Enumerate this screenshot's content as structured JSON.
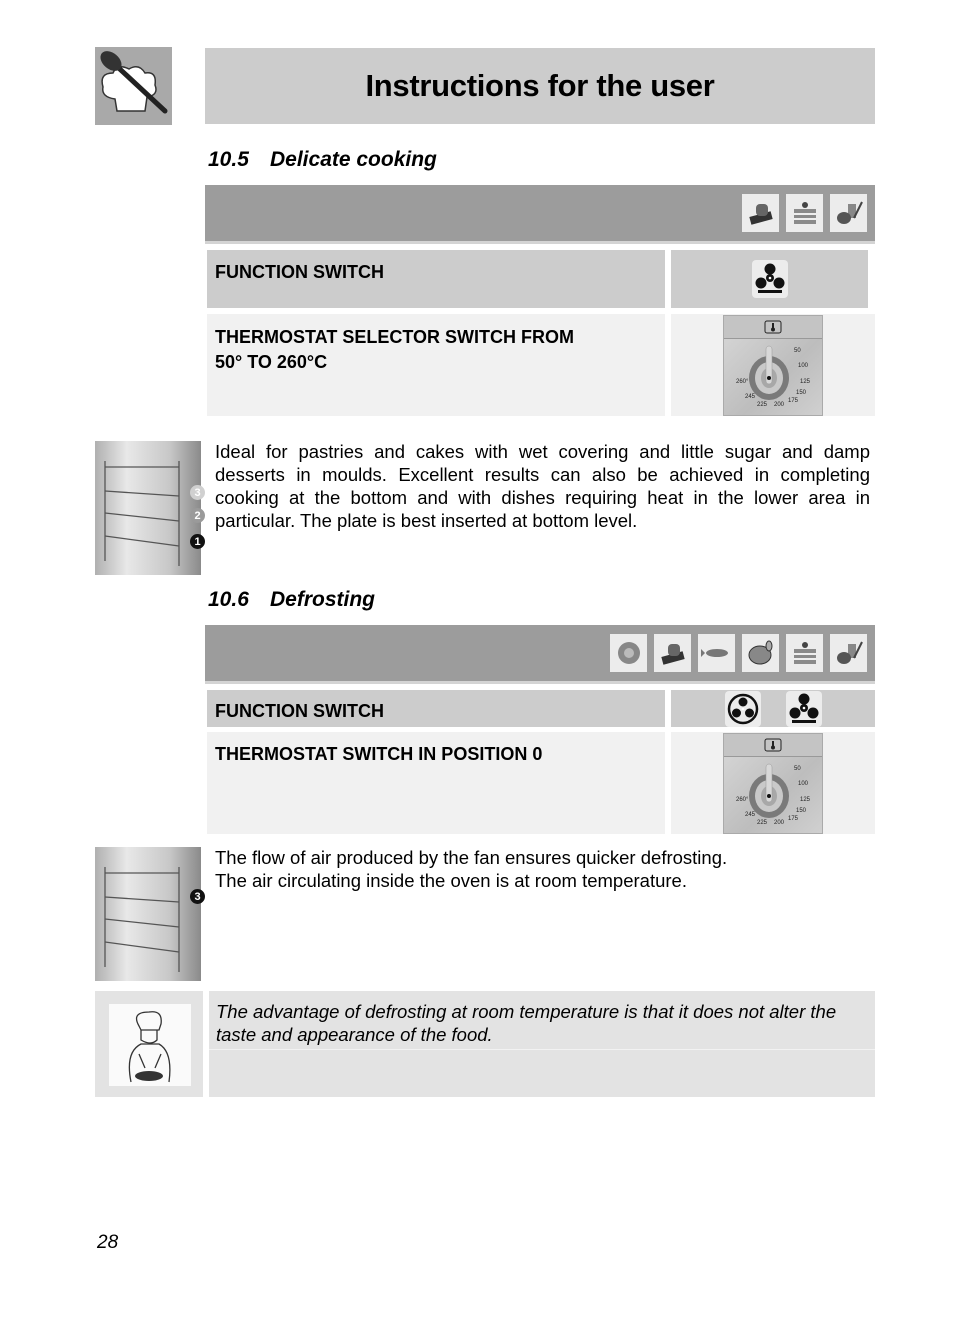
{
  "header": {
    "title": "Instructions for the user",
    "logo_icon": "chef-hat-spoon-icon"
  },
  "sections": [
    {
      "number": "10.5",
      "title": "Delicate cooking",
      "food_icons": [
        "bread-icon",
        "cake-icon",
        "vegetables-icon"
      ],
      "rows": [
        {
          "label": "FUNCTION SWITCH",
          "icons": [
            "fan-bottom-heat-icon"
          ]
        },
        {
          "label_line1": "THERMOSTAT SELECTOR SWITCH FROM",
          "label_line2": "50° TO 260°C",
          "icons": [
            "thermostat-dial-icon"
          ]
        }
      ],
      "shelf_levels": [
        "3",
        "2",
        "1"
      ],
      "highlighted_level": "1",
      "description": "Ideal for pastries and cakes with wet covering and little sugar and damp desserts in moulds. Excellent results can also be achieved in completing cooking at the bottom and with dishes requiring heat in the lower area in particular. The plate is best inserted at bottom level."
    },
    {
      "number": "10.6",
      "title": "Defrosting",
      "food_icons": [
        "meat-icon",
        "bread-icon",
        "fish-icon",
        "poultry-icon",
        "cake-icon",
        "vegetables-icon"
      ],
      "rows": [
        {
          "label": "FUNCTION SWITCH",
          "icons": [
            "fan-circle-icon",
            "fan-bottom-heat-icon"
          ]
        },
        {
          "label": "THERMOSTAT SWITCH IN POSITION 0",
          "icons": [
            "thermostat-dial-icon"
          ]
        }
      ],
      "shelf_levels": [
        "3"
      ],
      "highlighted_level": "3",
      "description_line1": "The flow of air produced by the fan ensures quicker defrosting.",
      "description_line2": "The air circulating inside the oven is at room temperature."
    }
  ],
  "dial": {
    "marks": [
      "50",
      "100",
      "125",
      "150",
      "175",
      "200",
      "225",
      "245",
      "260°"
    ]
  },
  "tip": {
    "icon": "chef-icon",
    "text": "The advantage of defrosting at room temperature is that it does not alter the taste and appearance of the food."
  },
  "page_number": "28"
}
